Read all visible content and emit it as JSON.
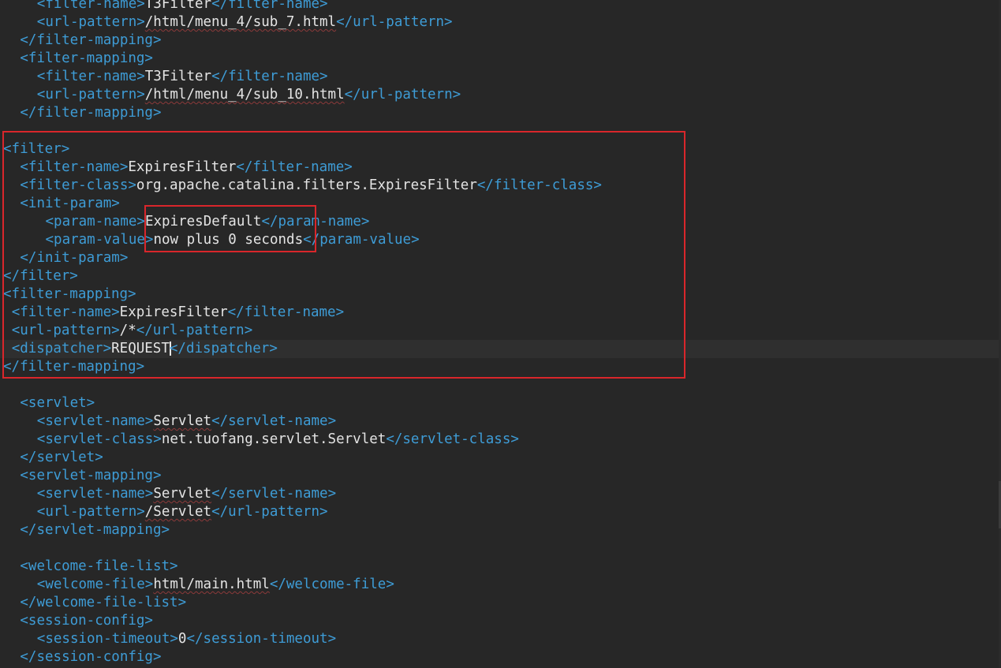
{
  "editor": {
    "lines": [
      {
        "indent": 4,
        "tag": "filter-name",
        "text": "T3Filter",
        "squiggle": false
      },
      {
        "indent": 4,
        "tag": "url-pattern",
        "text": "/html/menu_4/sub_7.html",
        "squiggle": true
      },
      {
        "indent": 2,
        "close": "filter-mapping"
      },
      {
        "indent": 2,
        "open": "filter-mapping"
      },
      {
        "indent": 4,
        "tag": "filter-name",
        "text": "T3Filter",
        "squiggle": false
      },
      {
        "indent": 4,
        "tag": "url-pattern",
        "text": "/html/menu_4/sub_10.html",
        "squiggle": true
      },
      {
        "indent": 2,
        "close": "filter-mapping"
      },
      {
        "blank": true
      },
      {
        "indent": 0,
        "open": "filter"
      },
      {
        "indent": 2,
        "tag": "filter-name",
        "text": "ExpiresFilter"
      },
      {
        "indent": 2,
        "tag": "filter-class",
        "text": "org.apache.catalina.filters.ExpiresFilter"
      },
      {
        "indent": 2,
        "open": "init-param"
      },
      {
        "indent": 5,
        "tag": "param-name",
        "text": "ExpiresDefault"
      },
      {
        "indent": 5,
        "tag": "param-value",
        "text": "now plus 0 seconds"
      },
      {
        "indent": 2,
        "close": "init-param"
      },
      {
        "indent": 0,
        "close": "filter"
      },
      {
        "indent": 0,
        "open": "filter-mapping"
      },
      {
        "indent": 1,
        "tag": "filter-name",
        "text": "ExpiresFilter"
      },
      {
        "indent": 1,
        "tag": "url-pattern",
        "text": "/*"
      },
      {
        "indent": 1,
        "tag": "dispatcher",
        "text": "REQUEST",
        "caret": true
      },
      {
        "indent": 0,
        "close": "filter-mapping"
      },
      {
        "blank": true
      },
      {
        "indent": 2,
        "open": "servlet"
      },
      {
        "indent": 4,
        "tag": "servlet-name",
        "text": "Servlet",
        "squiggle": true
      },
      {
        "indent": 4,
        "tag": "servlet-class",
        "text": "net.tuofang.servlet.Servlet"
      },
      {
        "indent": 2,
        "close": "servlet"
      },
      {
        "indent": 2,
        "open": "servlet-mapping"
      },
      {
        "indent": 4,
        "tag": "servlet-name",
        "text": "Servlet",
        "squiggle": true
      },
      {
        "indent": 4,
        "tag": "url-pattern",
        "text": "/Servlet",
        "squiggle": true
      },
      {
        "indent": 2,
        "close": "servlet-mapping"
      },
      {
        "blank": true
      },
      {
        "indent": 2,
        "open": "welcome-file-list"
      },
      {
        "indent": 4,
        "tag": "welcome-file",
        "text": "html/main.html",
        "squiggle": true
      },
      {
        "indent": 2,
        "close": "welcome-file-list"
      },
      {
        "indent": 2,
        "open": "session-config"
      },
      {
        "indent": 4,
        "tag": "session-timeout",
        "text": "0"
      },
      {
        "indent": 2,
        "close": "session-config"
      }
    ]
  },
  "colors": {
    "background": "#272727",
    "tag": "#3e9cd6",
    "text": "#e4e4e4",
    "highlight_box": "#d9262b"
  }
}
